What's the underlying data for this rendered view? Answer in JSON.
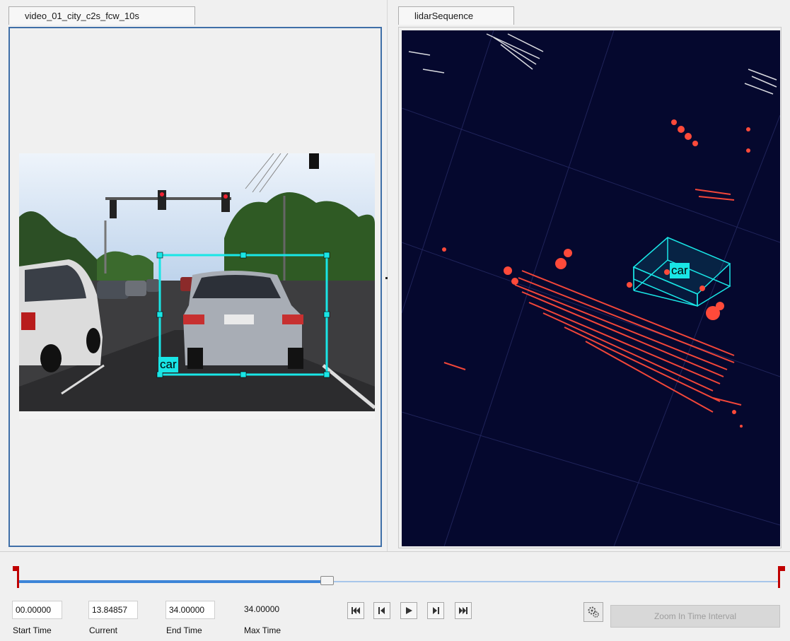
{
  "tabs": {
    "video": "video_01_city_c2s_fcw_10s",
    "lidar": "lidarSequence"
  },
  "annotations": {
    "video_label": "car",
    "lidar_label": "car"
  },
  "timeline": {
    "start_time": "00.00000",
    "current": "13.84857",
    "end_time": "34.00000",
    "max_time": "34.00000",
    "start_time_label": "Start Time",
    "current_label": "Current",
    "end_time_label": "End Time",
    "max_time_label": "Max Time",
    "playhead_fraction": 0.407
  },
  "controls": {
    "icons": [
      "skip-to-start-icon",
      "step-back-icon",
      "play-icon",
      "step-forward-icon",
      "skip-to-end-icon",
      "settings-gear-icon"
    ],
    "zoom_label": "Zoom In Time Interval"
  },
  "colors": {
    "label_box": "#19e6e6",
    "lidar_points": "#ff4a3a",
    "lidar_background": "#05082e",
    "slider_active": "#3d85d8",
    "flag": "#c00000"
  }
}
